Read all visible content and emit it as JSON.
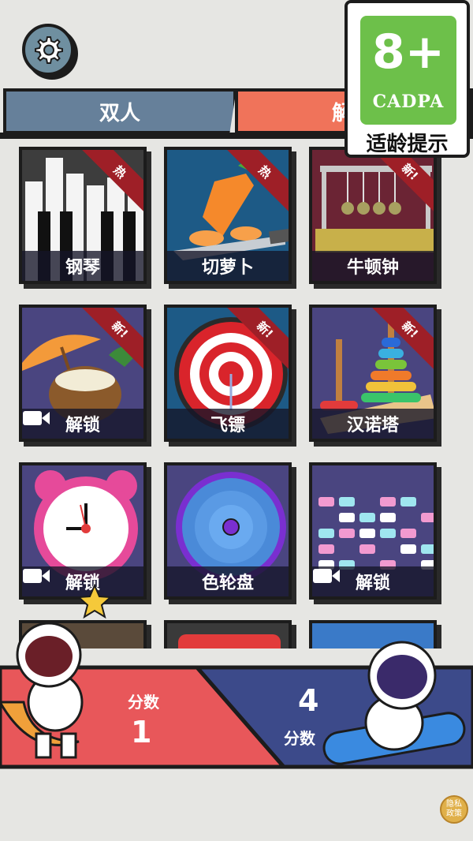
{
  "tabs": {
    "left": "双人",
    "right": "解"
  },
  "age_badge": {
    "rating": "8+",
    "org": "CADPA",
    "tip": "适龄提示"
  },
  "games": [
    {
      "label": "钢琴",
      "ribbon": "热"
    },
    {
      "label": "切萝卜",
      "ribbon": "热"
    },
    {
      "label": "牛顿钟",
      "ribbon": "新!"
    },
    {
      "label": "解锁",
      "ribbon": "新!"
    },
    {
      "label": "飞镖",
      "ribbon": "新!"
    },
    {
      "label": "汉诺塔",
      "ribbon": "新!"
    },
    {
      "label": "解锁",
      "ribbon": ""
    },
    {
      "label": "色轮盘",
      "ribbon": ""
    },
    {
      "label": "解锁",
      "ribbon": ""
    }
  ],
  "scores": {
    "left_label": "分数",
    "left_value": "1",
    "right_label": "分数",
    "right_value": "4"
  },
  "privacy": {
    "label": "隐私政策"
  },
  "colors": {
    "accent": "#f0735a",
    "tab_blue": "#66809a",
    "score_red": "#e8575a",
    "score_blue": "#3c4a8a"
  }
}
